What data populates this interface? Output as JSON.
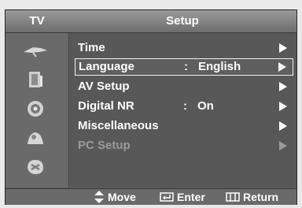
{
  "header": {
    "tv_label": "TV",
    "title": "Setup"
  },
  "sidebar": {
    "icons": [
      "antenna-icon",
      "picture-icon",
      "sound-icon",
      "channel-icon",
      "setup-icon"
    ]
  },
  "menu": {
    "items": [
      {
        "label": "Time",
        "colon": "",
        "value": ""
      },
      {
        "label": "Language",
        "colon": ":",
        "value": "English"
      },
      {
        "label": "AV Setup",
        "colon": "",
        "value": ""
      },
      {
        "label": "Digital NR",
        "colon": ":",
        "value": "On"
      },
      {
        "label": "Miscellaneous",
        "colon": "",
        "value": ""
      },
      {
        "label": "PC Setup",
        "colon": "",
        "value": ""
      }
    ],
    "selected": "Language",
    "disabled": "PC Setup"
  },
  "footer": {
    "move": "Move",
    "enter": "Enter",
    "return": "Return"
  },
  "colors": {
    "background": "#585858",
    "header": "#8a8a8a",
    "text": "#ffffff",
    "disabled_text": "#9a9a9a"
  }
}
